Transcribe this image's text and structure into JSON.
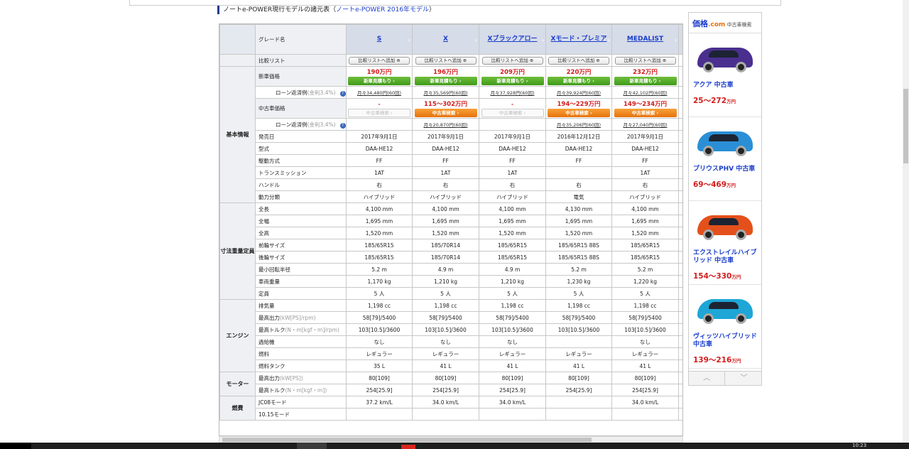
{
  "heading": {
    "prefix": "ノートe-POWER現行モデルの諸元表（",
    "link": "ノートe-POWER 2016年モデル",
    "suffix": "）"
  },
  "spec_table": {
    "grade_label": "グレード名",
    "compare_label": "比較リスト",
    "grades": [
      "S",
      "X",
      "Xブラックアロー",
      "Xモード・プレミア",
      "MEDALIST"
    ],
    "compare_button": "比較リストへ追加 ⊕",
    "sections": [
      {
        "name": "基本情報",
        "rows": [
          {
            "label": "新車価格",
            "kind": "newprice",
            "values": [
              "190万円",
              "196万円",
              "209万円",
              "220万円",
              "232万円"
            ],
            "button": "新車見積もり ›"
          },
          {
            "label": "ローン返済例",
            "unit": "(金利3.4%)",
            "kind": "loan",
            "values": [
              "月々34,480円(60回)",
              "月々35,569円(60回)",
              "月々37,928円(60回)",
              "月々39,924円(60回)",
              "月々42,102円(60回)"
            ]
          },
          {
            "label": "中古車価格",
            "kind": "usedprice",
            "values": [
              "-",
              "115～302万円",
              "-",
              "194～229万円",
              "149～234万円"
            ],
            "enabled": [
              false,
              true,
              false,
              true,
              true
            ],
            "button": "中古車検索 ›"
          },
          {
            "label": "ローン返済例",
            "unit": "(金利3.4%)",
            "kind": "loan",
            "values": [
              "",
              "月々20,870円(60回)",
              "",
              "月々35,206円(60回)",
              "月々27,040円(60回)"
            ]
          },
          {
            "label": "発売日",
            "values": [
              "2017年9月1日",
              "2017年9月1日",
              "2017年9月1日",
              "2016年12月12日",
              "2017年9月1日"
            ]
          },
          {
            "label": "型式",
            "values": [
              "DAA-HE12",
              "DAA-HE12",
              "DAA-HE12",
              "DAA-HE12",
              "DAA-HE12"
            ]
          },
          {
            "label": "駆動方式",
            "values": [
              "FF",
              "FF",
              "FF",
              "FF",
              "FF"
            ]
          },
          {
            "label": "トランスミッション",
            "values": [
              "1AT",
              "1AT",
              "1AT",
              "",
              "1AT"
            ]
          },
          {
            "label": "ハンドル",
            "values": [
              "右",
              "右",
              "右",
              "右",
              "右"
            ]
          },
          {
            "label": "動力分類",
            "values": [
              "ハイブリッド",
              "ハイブリッド",
              "ハイブリッド",
              "電気",
              "ハイブリッド"
            ]
          }
        ]
      },
      {
        "name": "寸法重量定員",
        "rows": [
          {
            "label": "全長",
            "values": [
              "4,100 mm",
              "4,100 mm",
              "4,100 mm",
              "4,130 mm",
              "4,100 mm"
            ]
          },
          {
            "label": "全幅",
            "values": [
              "1,695 mm",
              "1,695 mm",
              "1,695 mm",
              "1,695 mm",
              "1,695 mm"
            ]
          },
          {
            "label": "全高",
            "values": [
              "1,520 mm",
              "1,520 mm",
              "1,520 mm",
              "1,520 mm",
              "1,520 mm"
            ]
          },
          {
            "label": "前輪サイズ",
            "values": [
              "185/65R15",
              "185/70R14",
              "185/65R15",
              "185/65R15 88S",
              "185/65R15"
            ]
          },
          {
            "label": "後輪サイズ",
            "values": [
              "185/65R15",
              "185/70R14",
              "185/65R15",
              "185/65R15 88S",
              "185/65R15"
            ]
          },
          {
            "label": "最小回転半径",
            "values": [
              "5.2 m",
              "4.9 m",
              "4.9 m",
              "5.2 m",
              "5.2 m"
            ]
          },
          {
            "label": "車両重量",
            "values": [
              "1,170 kg",
              "1,210 kg",
              "1,210 kg",
              "1,230 kg",
              "1,220 kg"
            ]
          },
          {
            "label": "定員",
            "values": [
              "5 人",
              "5 人",
              "5 人",
              "5 人",
              "5 人"
            ]
          }
        ]
      },
      {
        "name": "エンジン",
        "rows": [
          {
            "label": "排気量",
            "values": [
              "1,198 cc",
              "1,198 cc",
              "1,198 cc",
              "1,198 cc",
              "1,198 cc"
            ]
          },
          {
            "label": "最高出力",
            "unit": "(kW[PS]/rpm)",
            "values": [
              "58[79]/5400",
              "58[79]/5400",
              "58[79]/5400",
              "58[79]/5400",
              "58[79]/5400"
            ]
          },
          {
            "label": "最高トルク",
            "unit": "(N・m[kgf・m]/rpm)",
            "values": [
              "103[10.5]/3600",
              "103[10.5]/3600",
              "103[10.5]/3600",
              "103[10.5]/3600",
              "103[10.5]/3600"
            ]
          },
          {
            "label": "過給機",
            "values": [
              "なし",
              "なし",
              "なし",
              "",
              "なし"
            ]
          },
          {
            "label": "燃料",
            "values": [
              "レギュラー",
              "レギュラー",
              "レギュラー",
              "レギュラー",
              "レギュラー"
            ]
          },
          {
            "label": "燃料タンク",
            "values": [
              "35 L",
              "41 L",
              "41 L",
              "41 L",
              "41 L"
            ]
          }
        ]
      },
      {
        "name": "モーター",
        "rows": [
          {
            "label": "最高出力",
            "unit": "(kW[PS])",
            "values": [
              "80[109]",
              "80[109]",
              "80[109]",
              "80[109]",
              "80[109]"
            ]
          },
          {
            "label": "最高トルク",
            "unit": "(N・m[kgf・m])",
            "values": [
              "254[25.9]",
              "254[25.9]",
              "254[25.9]",
              "254[25.9]",
              "254[25.9]"
            ]
          }
        ]
      },
      {
        "name": "燃費",
        "rows": [
          {
            "label": "JC08モード",
            "values": [
              "37.2 km/L",
              "34.0 km/L",
              "34.0 km/L",
              "",
              "34.0 km/L"
            ]
          },
          {
            "label": "10.15モード",
            "values": [
              "",
              "",
              "",
              "",
              ""
            ]
          }
        ]
      }
    ]
  },
  "ad": {
    "logo_main": "価格",
    "logo_dom": ".com",
    "logo_sub": "中古車検索",
    "items": [
      {
        "name": "アクア 中古車",
        "price": "25～272",
        "unit": "万円",
        "color": "#4a2f8f",
        "icon": "car-aqua-image"
      },
      {
        "name": "プリウスPHV 中古車",
        "price": "69～469",
        "unit": "万円",
        "color": "#2a8fd6",
        "icon": "car-prius-phv-image"
      },
      {
        "name": "エクストレイルハイブリッド 中古車",
        "price": "154～330",
        "unit": "万円",
        "color": "#e4501b",
        "icon": "car-x-trail-image"
      },
      {
        "name": "ヴィッツハイブリッド 中古車",
        "price": "139～216",
        "unit": "万円",
        "color": "#1ea6d6",
        "icon": "car-vitz-image"
      }
    ],
    "nav_up": "︿",
    "nav_down": "﹀"
  },
  "taskbar": {
    "clock": "10:23"
  }
}
